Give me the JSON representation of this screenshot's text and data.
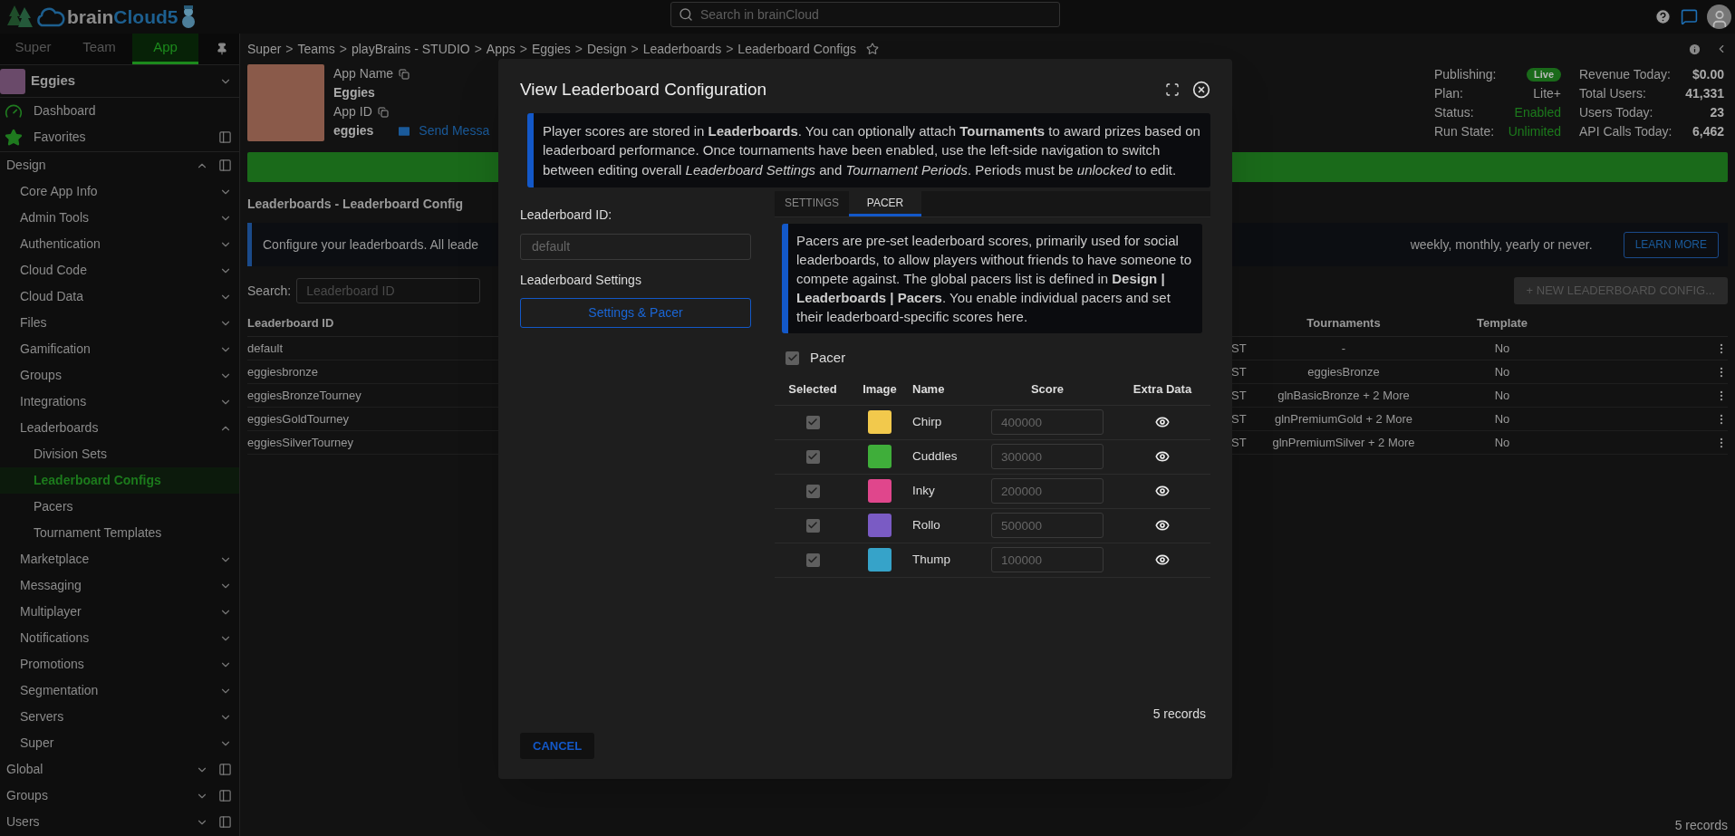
{
  "top_bar": {
    "logo": {
      "text_1": "brain",
      "text_2": "Cloud5"
    },
    "search": {
      "placeholder": "Search in brainCloud"
    }
  },
  "sidebar": {
    "tabs": [
      {
        "label": "Super",
        "selected": false
      },
      {
        "label": "Team",
        "selected": false
      },
      {
        "label": "App",
        "selected": true
      }
    ],
    "app": {
      "name": "Eggies"
    },
    "items": [
      {
        "label": "Dashboard",
        "kind": "dashboard",
        "has_panel": false
      },
      {
        "label": "Favorites",
        "kind": "favorites",
        "has_panel": true
      },
      {
        "label": "Design",
        "kind": "section",
        "has_panel": true,
        "expanded": true,
        "children": [
          {
            "label": "Core App Info",
            "expanded": false
          },
          {
            "label": "Admin Tools",
            "expanded": false
          },
          {
            "label": "Authentication",
            "expanded": false
          },
          {
            "label": "Cloud Code",
            "expanded": false
          },
          {
            "label": "Cloud Data",
            "expanded": false
          },
          {
            "label": "Files",
            "expanded": false
          },
          {
            "label": "Gamification",
            "expanded": false
          },
          {
            "label": "Groups",
            "expanded": false
          },
          {
            "label": "Integrations",
            "expanded": false
          },
          {
            "label": "Leaderboards",
            "expanded": true,
            "children": [
              {
                "label": "Division Sets",
                "selected": false
              },
              {
                "label": "Leaderboard Configs",
                "selected": true
              },
              {
                "label": "Pacers",
                "selected": false
              },
              {
                "label": "Tournament Templates",
                "selected": false
              }
            ]
          },
          {
            "label": "Marketplace",
            "expanded": false
          },
          {
            "label": "Messaging",
            "expanded": false
          },
          {
            "label": "Multiplayer",
            "expanded": false
          },
          {
            "label": "Notifications",
            "expanded": false
          },
          {
            "label": "Promotions",
            "expanded": false
          },
          {
            "label": "Segmentation",
            "expanded": false
          },
          {
            "label": "Servers",
            "expanded": false
          },
          {
            "label": "Super",
            "expanded": false
          }
        ]
      },
      {
        "label": "Global",
        "kind": "section",
        "has_panel": true,
        "expanded": false
      },
      {
        "label": "Groups",
        "kind": "section",
        "has_panel": true,
        "expanded": false
      },
      {
        "label": "Users",
        "kind": "section",
        "has_panel": true,
        "expanded": false
      }
    ]
  },
  "breadcrumb": {
    "separator": ">",
    "items": [
      "Super",
      "Teams",
      "playBrains - STUDIO",
      "Apps",
      "Eggies",
      "Design",
      "Leaderboards",
      "Leaderboard Configs"
    ]
  },
  "app_header": {
    "app_name_label": "App Name",
    "app_name": "Eggies",
    "app_id_label": "App ID",
    "app_id": "eggies",
    "send_message": "Send Messa",
    "status": [
      {
        "label": "Publishing:",
        "value": "Live",
        "kind": "badge"
      },
      {
        "label": "Plan:",
        "value": "Lite+",
        "kind": "plain"
      },
      {
        "label": "Status:",
        "value": "Enabled",
        "kind": "good"
      },
      {
        "label": "Run State:",
        "value": "Unlimited",
        "kind": "good"
      }
    ],
    "stats": [
      {
        "label": "Revenue Today:",
        "value": "$0.00"
      },
      {
        "label": "Total Users:",
        "value": "41,331"
      },
      {
        "label": "Users Today:",
        "value": "23"
      },
      {
        "label": "API Calls Today:",
        "value": "6,462"
      }
    ]
  },
  "page": {
    "progress": {
      "level": 1
    },
    "title": "Leaderboards - Leaderboard Config",
    "banner_left": "Configure your leaderboards. All leade",
    "banner_right": "weekly, monthly, yearly or never.",
    "learn_more": "LEARN MORE",
    "search_label": "Search:",
    "search_placeholder": "Leaderboard ID",
    "new_button": "+ NEW LEADERBOARD CONFIG...",
    "columns": {
      "id": "Leaderboard ID",
      "tournaments": "Tournaments",
      "template": "Template"
    },
    "rows": [
      {
        "id": "default",
        "column_2": "ST",
        "tournaments": "-",
        "template": "No"
      },
      {
        "id": "eggiesbronze",
        "column_2": "ST",
        "tournaments": "eggiesBronze",
        "template": "No"
      },
      {
        "id": "eggiesBronzeTourney",
        "column_2": "ST",
        "tournaments": "glnBasicBronze + 2 More",
        "template": "No"
      },
      {
        "id": "eggiesGoldTourney",
        "column_2": "ST",
        "tournaments": "glnPremiumGold + 2 More",
        "template": "No"
      },
      {
        "id": "eggiesSilverTourney",
        "column_2": "ST",
        "tournaments": "glnPremiumSilver + 2 More",
        "template": "No"
      }
    ],
    "records": "5 records"
  },
  "modal": {
    "title": "View Leaderboard Configuration",
    "info": "Player scores are stored in **Leaderboards**. You can optionally attach **Tournaments** to award prizes based on leaderboard performance. Once tournaments have been enabled, use the left-side navigation to switch between editing overall *Leaderboard Settings* and *Tournament Periods*. Periods must be *unlocked* to edit.",
    "id_label": "Leaderboard ID:",
    "id_value": "default",
    "settings_label": "Leaderboard Settings",
    "settings_button": "Settings & Pacer",
    "tabs": [
      {
        "label": "SETTINGS",
        "selected": false
      },
      {
        "label": "PACER",
        "selected": true
      }
    ],
    "pacer_info": "Pacers are pre-set leaderboard scores, primarily used for social leaderboards, to allow players without friends to have someone to compete against. The global pacers list is defined in **Design | Leaderboards | Pacers**. You enable individual pacers and set their leaderboard-specific scores here.",
    "pacer_toggle": {
      "label": "Pacer",
      "checked": true
    },
    "columns": [
      "Selected",
      "Image",
      "Name",
      "Score",
      "Extra Data"
    ],
    "pacers": [
      {
        "name": "Chirp",
        "score": "400000",
        "checked": true,
        "color": "#f2c94c"
      },
      {
        "name": "Cuddles",
        "score": "300000",
        "checked": true,
        "color": "#3fae3a"
      },
      {
        "name": "Inky",
        "score": "200000",
        "checked": true,
        "color": "#e0468c"
      },
      {
        "name": "Rollo",
        "score": "500000",
        "checked": true,
        "color": "#7a5bc4"
      },
      {
        "name": "Thump",
        "score": "100000",
        "checked": true,
        "color": "#36a3c9"
      }
    ],
    "records": "5 records",
    "cancel": "CANCEL"
  }
}
